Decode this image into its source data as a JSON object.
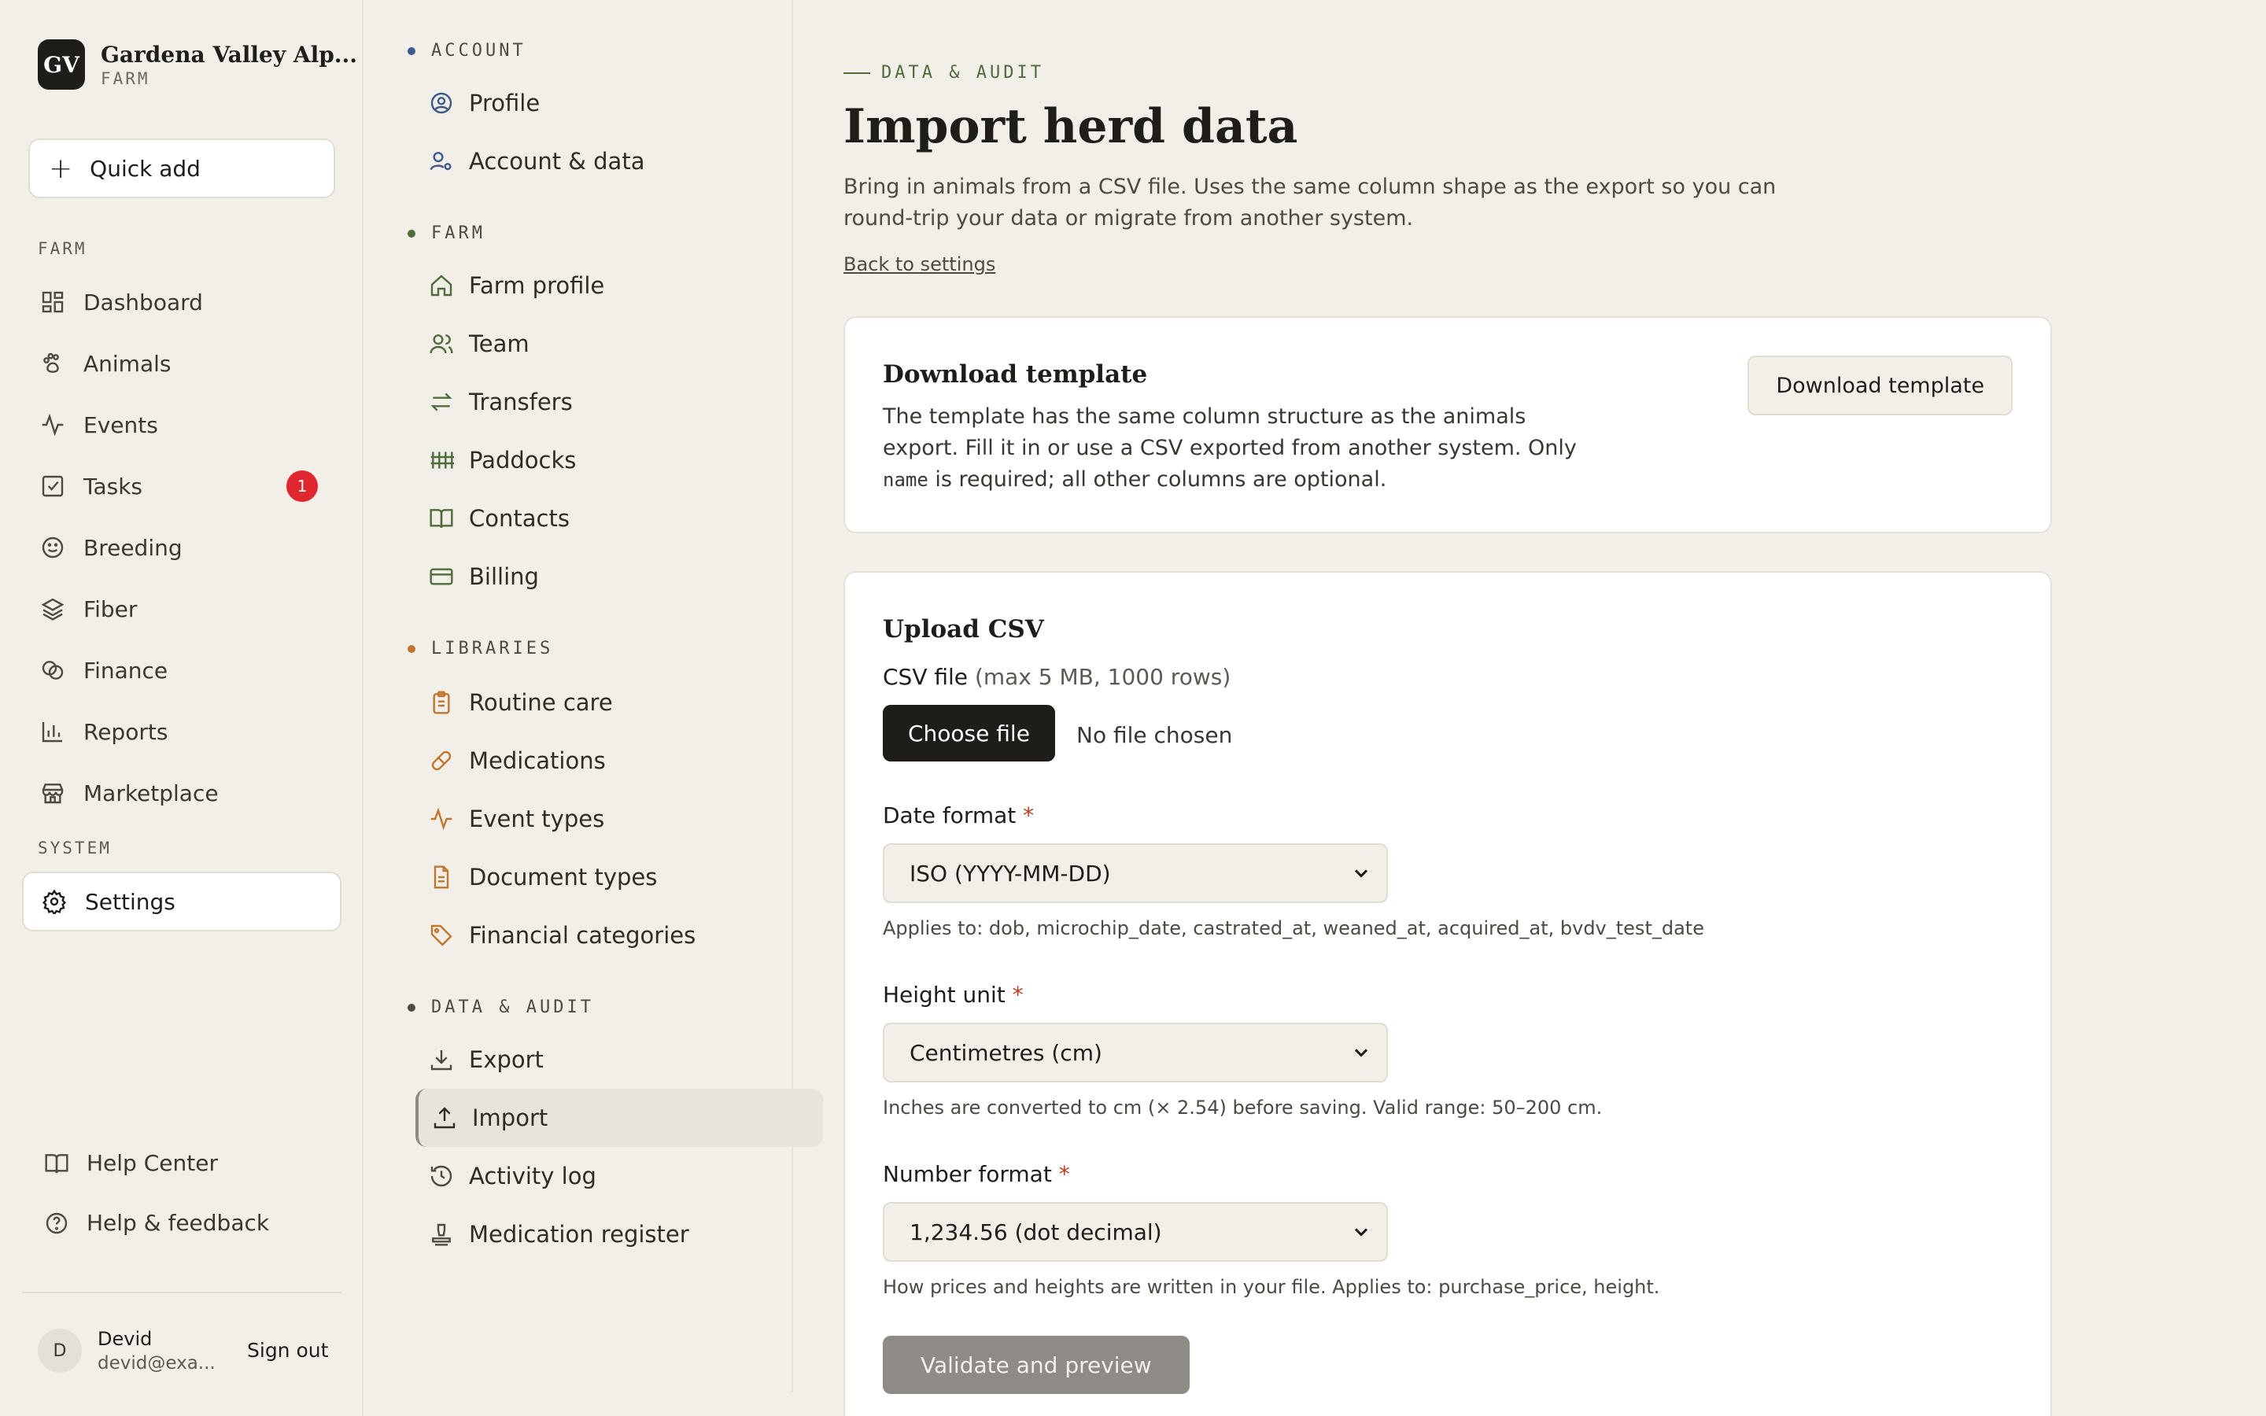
{
  "brand": {
    "logo": "GV",
    "name": "Gardena Valley Alp...",
    "sub": "FARM"
  },
  "quick_add": {
    "label": "Quick add"
  },
  "sidebar": {
    "farm_heading": "FARM",
    "system_heading": "SYSTEM",
    "items": [
      {
        "label": "Dashboard",
        "icon": "dashboard-icon"
      },
      {
        "label": "Animals",
        "icon": "paw-icon"
      },
      {
        "label": "Events",
        "icon": "activity-icon"
      },
      {
        "label": "Tasks",
        "icon": "check-square-icon",
        "badge": "1"
      },
      {
        "label": "Breeding",
        "icon": "smile-icon"
      },
      {
        "label": "Fiber",
        "icon": "layers-icon"
      },
      {
        "label": "Finance",
        "icon": "coins-icon"
      },
      {
        "label": "Reports",
        "icon": "bar-chart-icon"
      },
      {
        "label": "Marketplace",
        "icon": "store-icon"
      }
    ],
    "settings": "Settings",
    "help_center": "Help Center",
    "help_feedback": "Help & feedback",
    "user": {
      "initial": "D",
      "name": "Devid",
      "email": "devid@exa...",
      "signout": "Sign out"
    }
  },
  "subnav": {
    "sections": [
      {
        "heading": "ACCOUNT",
        "dot": "#3e5a8a",
        "items": [
          "Profile",
          "Account & data"
        ]
      },
      {
        "heading": "FARM",
        "dot": "#4e6b3a",
        "items": [
          "Farm profile",
          "Team",
          "Transfers",
          "Paddocks",
          "Contacts",
          "Billing"
        ]
      },
      {
        "heading": "LIBRARIES",
        "dot": "#c0762e",
        "items": [
          "Routine care",
          "Medications",
          "Event types",
          "Document types",
          "Financial categories"
        ]
      },
      {
        "heading": "DATA & AUDIT",
        "dot": "#4d4943",
        "items": [
          "Export",
          "Import",
          "Activity log",
          "Medication register"
        ]
      }
    ]
  },
  "main": {
    "eyebrow": "DATA & AUDIT",
    "title": "Import herd data",
    "description": "Bring in animals from a CSV file. Uses the same column shape as the export so you can round-trip your data or migrate from another system.",
    "back": "Back to settings",
    "template_card": {
      "title": "Download template",
      "text_1": "The template has the same column structure as the animals export. Fill it in or use a CSV exported from another system. Only",
      "code": "name",
      "text_2": "is required; all other columns are optional.",
      "button": "Download template"
    },
    "upload_card": {
      "title": "Upload CSV",
      "file_label": "CSV file",
      "file_limit": "(max 5 MB, 1000 rows)",
      "choose": "Choose file",
      "no_file": "No file chosen",
      "date_label": "Date format",
      "date_value": "ISO (YYYY-MM-DD)",
      "date_hint": "Applies to: dob, microchip_date, castrated_at, weaned_at, acquired_at, bvdv_test_date",
      "height_label": "Height unit",
      "height_value": "Centimetres (cm)",
      "height_hint": "Inches are converted to cm (× 2.54) before saving. Valid range: 50–200 cm.",
      "number_label": "Number format",
      "number_value": "1,234.56 (dot decimal)",
      "number_hint": "How prices and heights are written in your file. Applies to: purchase_price, height.",
      "required_mark": "*",
      "submit": "Validate and preview"
    }
  },
  "colors": {
    "accent_green": "#4e6b3a",
    "badge_red": "#e0262e",
    "library_orange": "#c0762e"
  }
}
